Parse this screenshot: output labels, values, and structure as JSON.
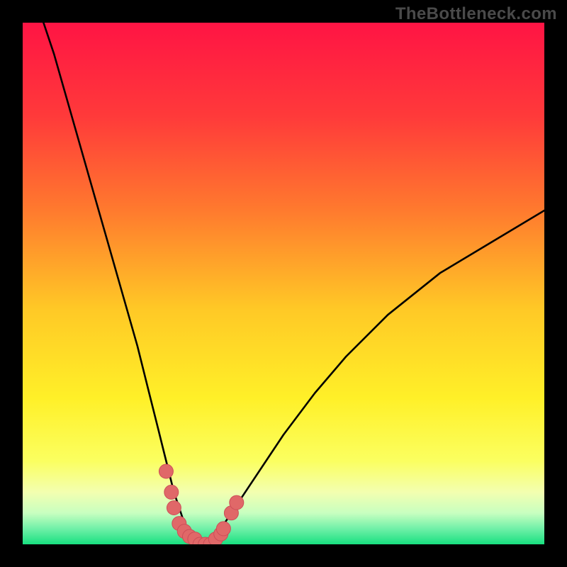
{
  "watermark": "TheBottleneck.com",
  "chart_data": {
    "type": "line",
    "title": "",
    "xlabel": "",
    "ylabel": "",
    "xlim": [
      0,
      100
    ],
    "ylim": [
      0,
      100
    ],
    "series": [
      {
        "name": "bottleneck-curve",
        "x": [
          4,
          6,
          8,
          10,
          12,
          14,
          16,
          18,
          20,
          22,
          24,
          26,
          27,
          28,
          29,
          30,
          31,
          32,
          33,
          34,
          35,
          36,
          38,
          40,
          44,
          50,
          56,
          62,
          70,
          80,
          90,
          100
        ],
        "y": [
          100,
          94,
          87,
          80,
          73,
          66,
          59,
          52,
          45,
          38,
          30,
          22,
          18,
          14,
          10,
          7,
          4,
          2,
          1,
          0,
          0,
          1,
          3,
          6,
          12,
          21,
          29,
          36,
          44,
          52,
          58,
          64
        ]
      }
    ],
    "markers": {
      "name": "highlighted-points",
      "x": [
        27.5,
        28.5,
        29,
        30,
        31,
        32,
        33,
        34,
        35,
        36,
        37,
        38,
        38.5,
        40,
        41
      ],
      "y": [
        14,
        10,
        7,
        4,
        2.5,
        1.5,
        1,
        0,
        0,
        0,
        1,
        2,
        3,
        6,
        8
      ]
    },
    "background_gradient": {
      "stops": [
        {
          "offset": 0.0,
          "color": "#ff1444"
        },
        {
          "offset": 0.18,
          "color": "#ff3a3a"
        },
        {
          "offset": 0.36,
          "color": "#ff7a2e"
        },
        {
          "offset": 0.55,
          "color": "#ffc926"
        },
        {
          "offset": 0.72,
          "color": "#fff028"
        },
        {
          "offset": 0.84,
          "color": "#fbff60"
        },
        {
          "offset": 0.9,
          "color": "#f3ffb0"
        },
        {
          "offset": 0.94,
          "color": "#c8ffc0"
        },
        {
          "offset": 0.97,
          "color": "#70f0a8"
        },
        {
          "offset": 1.0,
          "color": "#18e080"
        }
      ]
    },
    "colors": {
      "curve": "#000000",
      "marker_fill": "#e06868",
      "marker_stroke": "#cc4e58",
      "frame": "#000000"
    }
  }
}
